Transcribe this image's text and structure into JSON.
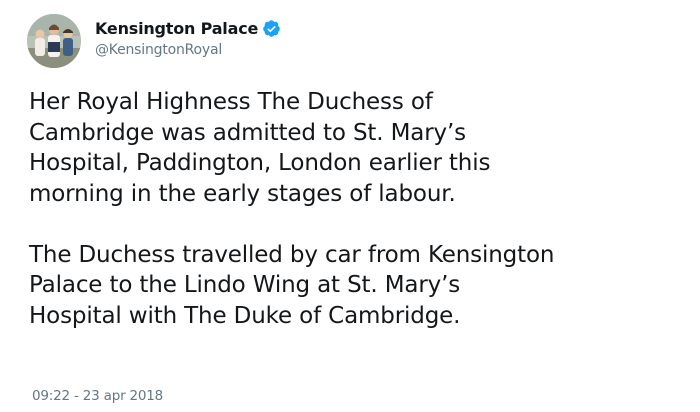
{
  "tweet": {
    "author": {
      "display_name": "Kensington Palace",
      "handle": "@KensingtonRoyal",
      "verified": true,
      "avatar_icon": "profile-photo",
      "verified_icon": "verified-badge-icon",
      "verified_color": "#1da1f2"
    },
    "paragraphs": [
      "Her Royal Highness The Duchess of\nCambridge was admitted to St. Mary’s\nHospital, Paddington, London earlier this\nmorning in the early stages of labour.",
      "The Duchess travelled by car from Kensington\nPalace to the Lindo Wing at St. Mary’s\nHospital with The Duke of Cambridge."
    ],
    "timestamp": "09:22 - 23 apr 2018"
  }
}
